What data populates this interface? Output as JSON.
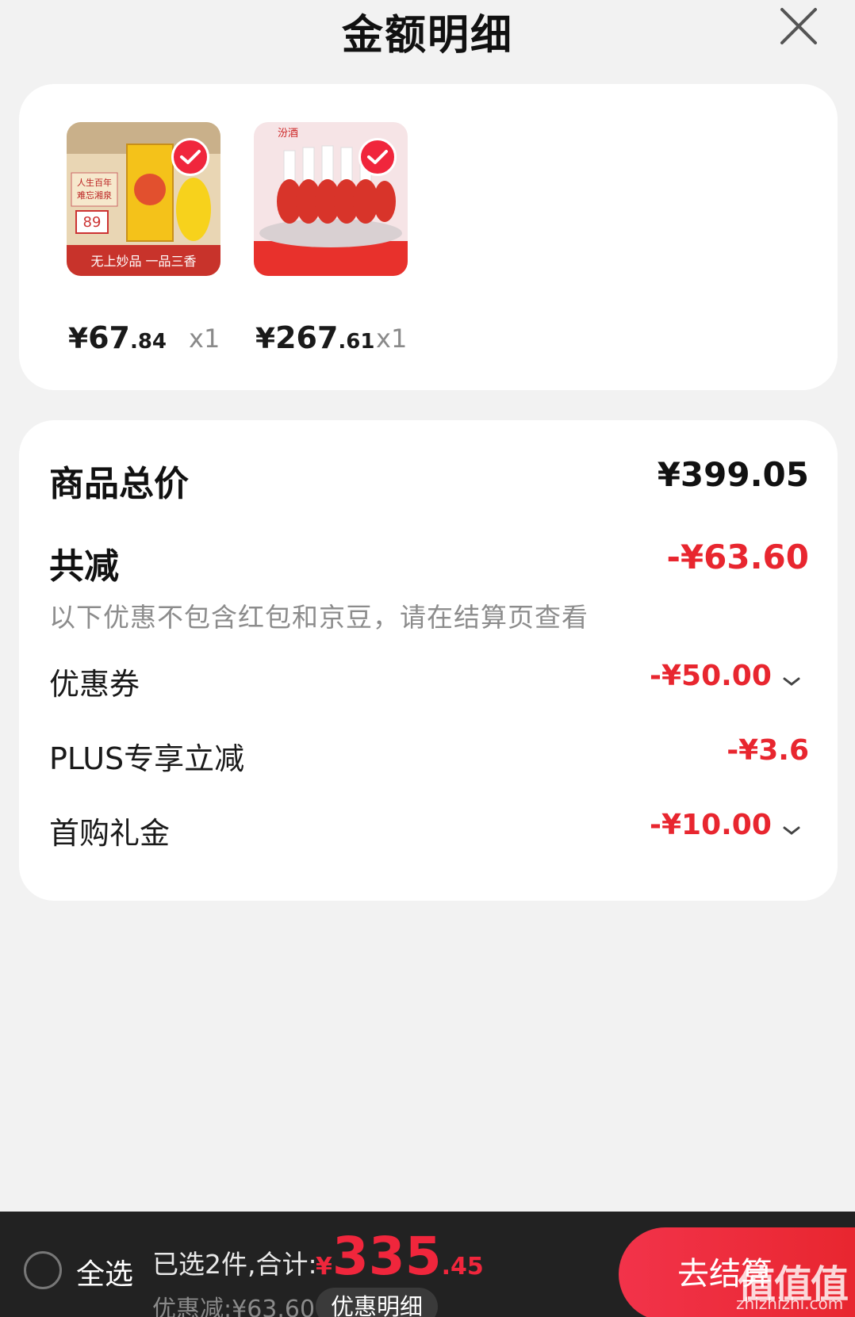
{
  "header": {
    "title": "金额明细"
  },
  "products": [
    {
      "currency": "¥",
      "price_int": "67",
      "price_dec": ".84",
      "qty": "x1",
      "label_top": "人生百年",
      "label_top2": "难忘湘泉",
      "badge": "89",
      "slogan": "无上妙品 一品三香"
    },
    {
      "currency": "¥",
      "price_int": "267",
      "price_dec": ".61",
      "qty": "x1",
      "brand": "汾酒"
    }
  ],
  "summary": {
    "total_label": "商品总价",
    "total_value": "¥399.05",
    "reduce_label": "共减",
    "reduce_value": "-¥63.60",
    "note": "以下优惠不包含红包和京豆，请在结算页查看",
    "items": [
      {
        "label": "优惠券",
        "value": "-¥50.00"
      },
      {
        "label": "PLUS专享立减",
        "value": "-¥3.6"
      },
      {
        "label": "首购礼金",
        "value": "-¥10.00"
      }
    ]
  },
  "footer": {
    "select_all": "全选",
    "selected_text": "已选2件,合计:",
    "total_currency": "¥",
    "total_int": "335",
    "total_dec": ".45",
    "discount_text": "优惠减:¥63.60",
    "detail_button": "优惠明细",
    "checkout_button": "去结算"
  },
  "watermark": {
    "text": "值值值",
    "url": "zhizhizhi.com"
  },
  "colors": {
    "accent": "#e8262f",
    "footer_bg": "#222222",
    "page_bg": "#f2f2f2"
  }
}
